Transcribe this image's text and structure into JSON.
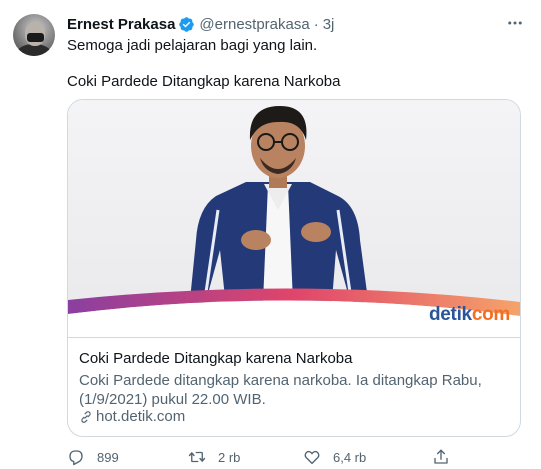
{
  "author": {
    "name": "Ernest Prakasa",
    "handle": "@ernestprakasa",
    "separator": "·",
    "time": "3j"
  },
  "tweet": {
    "line1": "Semoga jadi pelajaran bagi yang lain.",
    "line2": "Coki Pardede Ditangkap karena Narkoba"
  },
  "card": {
    "logo_text_a": "detik",
    "logo_text_b": "com",
    "title": "Coki Pardede Ditangkap karena Narkoba",
    "description": "Coki Pardede ditangkap karena narkoba. Ia ditangkap Rabu, (1/9/2021) pukul 22.00 WIB.",
    "domain": "hot.detik.com"
  },
  "actions": {
    "replies": "899",
    "retweets": "2 rb",
    "likes": "6,4 rb"
  },
  "colors": {
    "verified": "#1d9bf0",
    "secondary_text": "#536471",
    "border": "#cfd9de",
    "detik_blue": "#2a5599",
    "detik_orange": "#f26f21"
  },
  "icons": [
    "verified-badge-icon",
    "more-icon",
    "link-icon",
    "reply-icon",
    "retweet-icon",
    "like-icon",
    "share-icon"
  ]
}
